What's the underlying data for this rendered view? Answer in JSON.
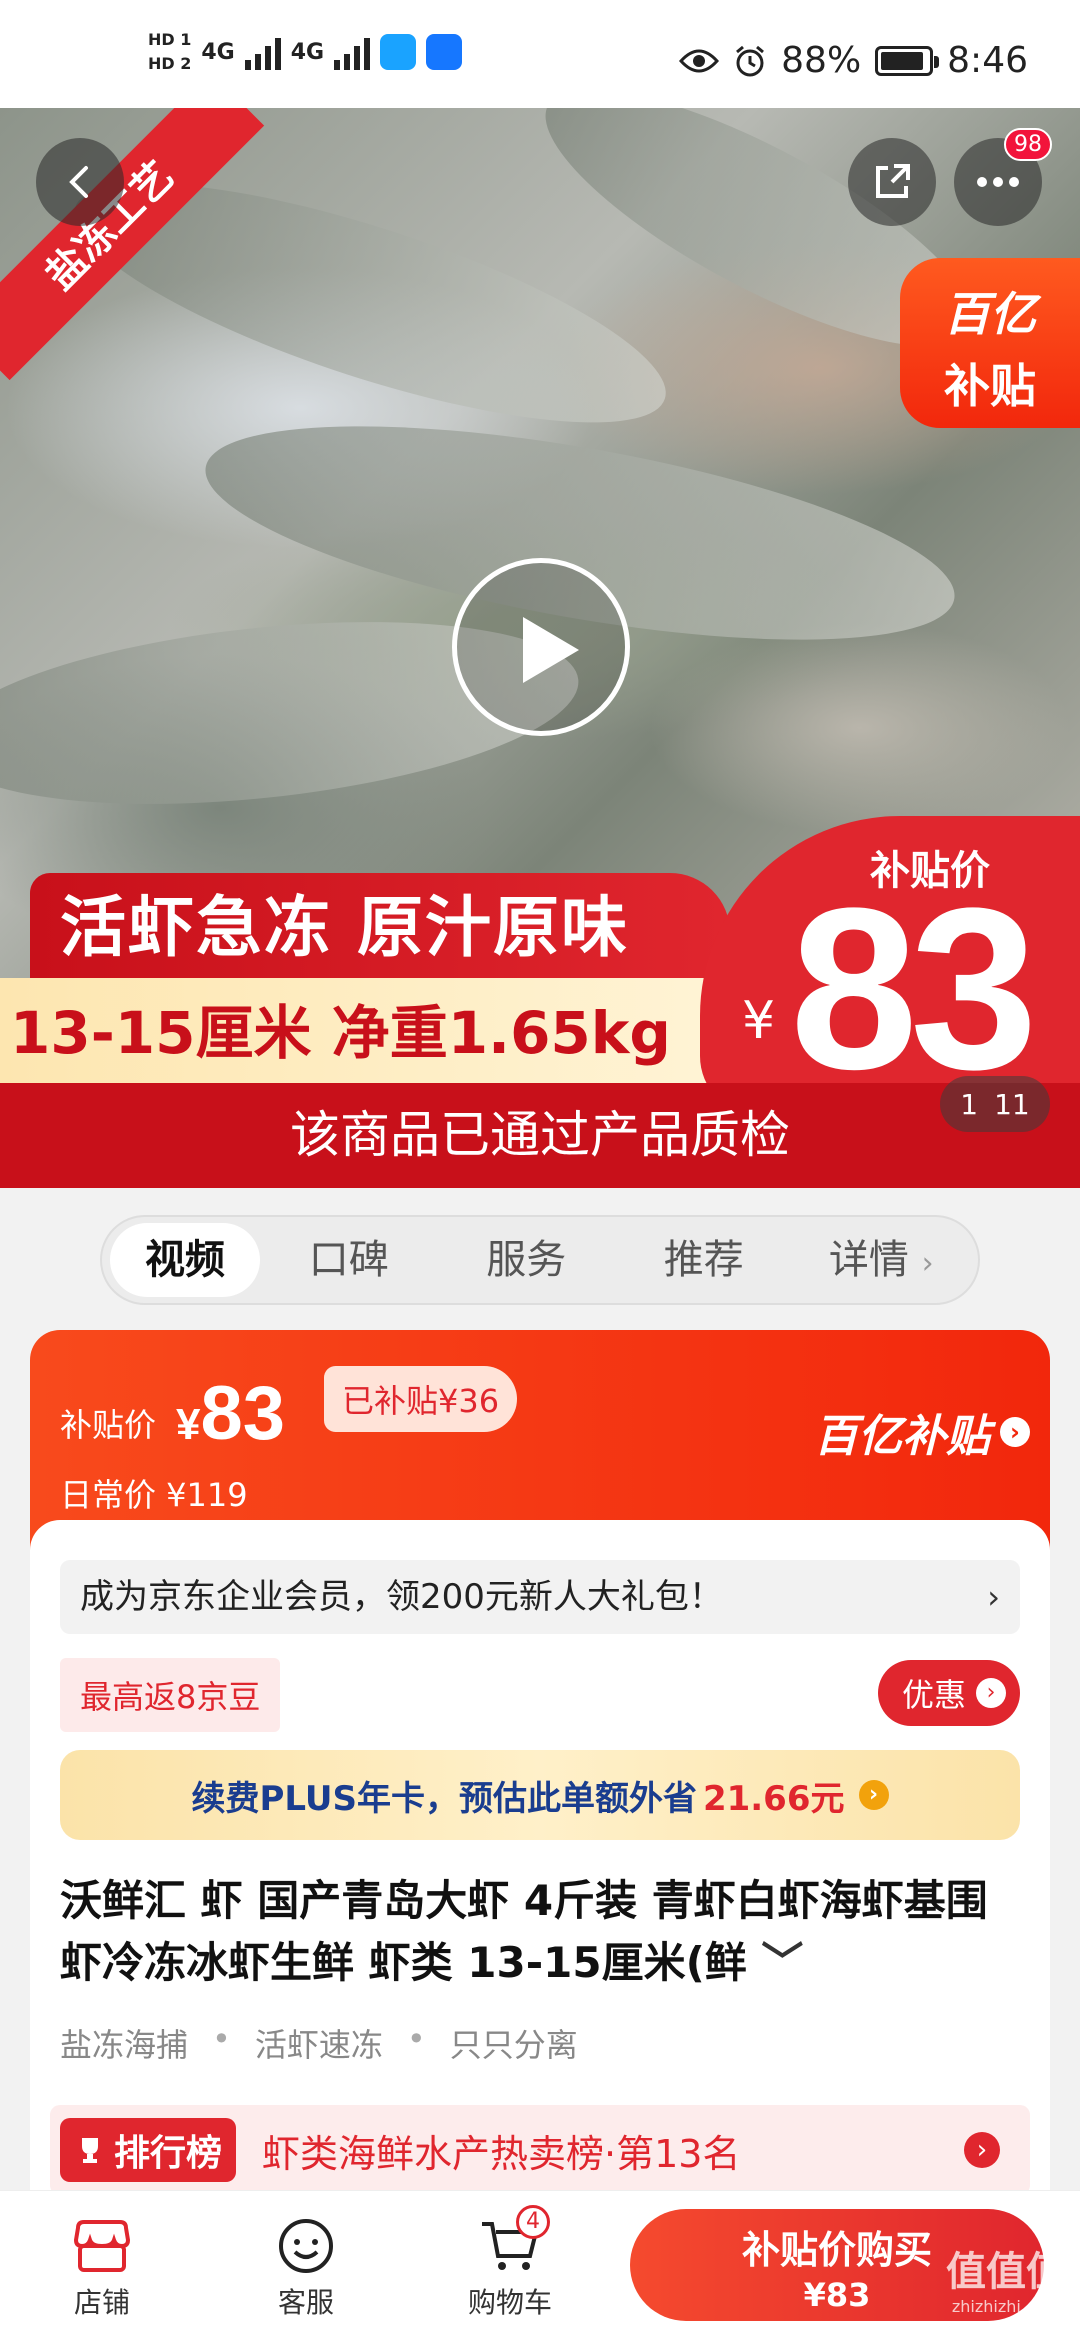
{
  "status_bar": {
    "battery": "88%",
    "time": "8:46",
    "network1": "4G",
    "network2": "4G",
    "hd1": "HD 1",
    "hd2": "HD 2"
  },
  "hero": {
    "corner_ribbon": "盐冻工艺",
    "menu_badge": "98",
    "subsidy_tag_line1": "百亿",
    "subsidy_tag_line2": "补贴",
    "banner_line1": "活虾急冻 原汁原味",
    "banner_line2": "13-15厘米 净重1.65kg",
    "price_label": "补贴价",
    "price_currency": "¥",
    "price_value": "83",
    "quality_text": "该商品已通过产品质检",
    "pager_current": "1",
    "pager_total": "11"
  },
  "tabs": [
    {
      "label": "视频"
    },
    {
      "label": "口碑"
    },
    {
      "label": "服务"
    },
    {
      "label": "推荐"
    },
    {
      "label": "详情"
    }
  ],
  "price_card": {
    "subsidy_label": "补贴价",
    "subsidy_currency": "¥",
    "subsidy_price": "83",
    "saved": "已补贴¥36",
    "daily_price": "日常价 ¥119",
    "brand": "百亿补贴"
  },
  "details": {
    "enterprise": "成为京东企业会员，领200元新人大礼包！",
    "jd_bean": "最高返8京豆",
    "youhui": "优惠",
    "plus_text": "续费PLUS年卡，预估此单额外省",
    "plus_amount": "21.66元",
    "title": "沃鲜汇 虾 国产青岛大虾 4斤装 青虾白虾海虾基围虾冷冻冰虾生鲜 虾类 13-15厘米(鲜",
    "tags": [
      "盐冻海捕",
      "活虾速冻",
      "只只分离"
    ],
    "rank_badge": "排行榜",
    "rank_text": "虾类海鲜水产热卖榜·第13名"
  },
  "bottom_bar": {
    "store": "店铺",
    "service": "客服",
    "cart": "购物车",
    "cart_count": "4",
    "buy_line1": "补贴价购买",
    "buy_line2": "¥83"
  },
  "watermark": {
    "main": "值值值",
    "sub": "zhizhizhi.com"
  },
  "colors": {
    "accent": "#e0262e",
    "orange": "#f84a1c",
    "plus_blue": "#1a3d8f"
  }
}
